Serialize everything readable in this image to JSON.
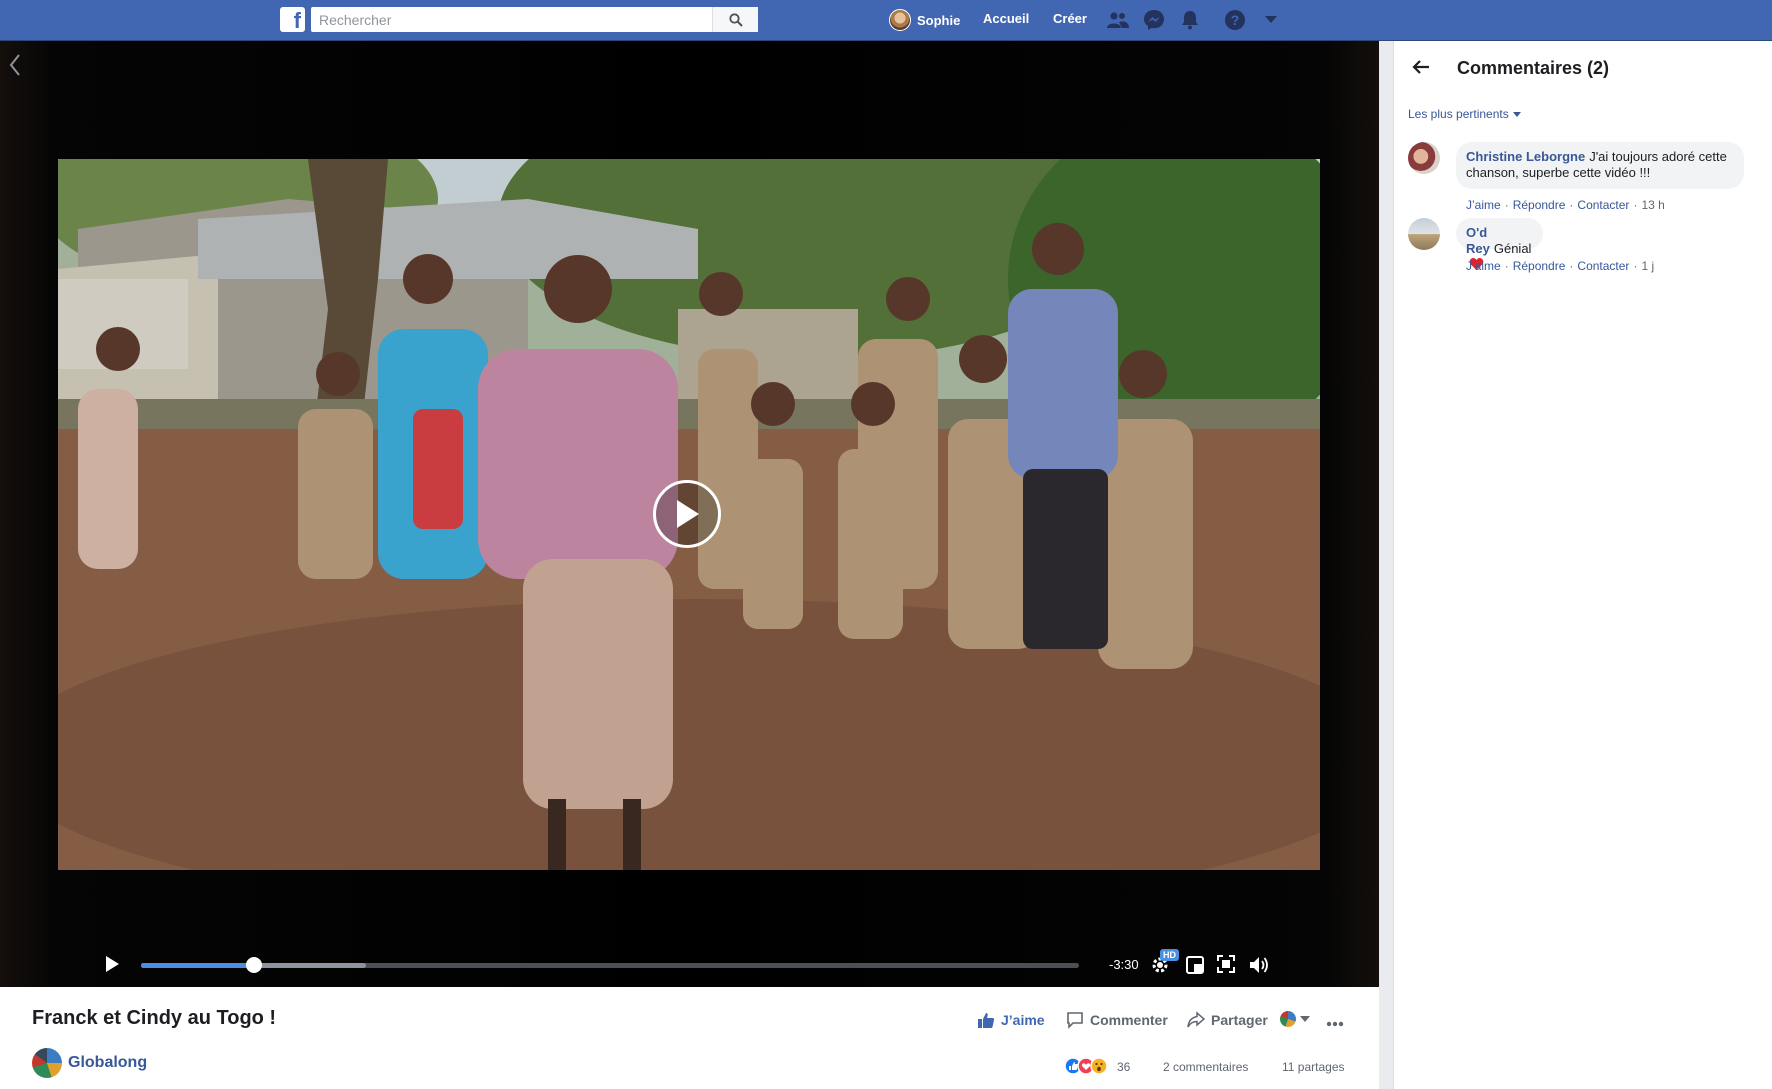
{
  "topbar": {
    "logo": "f",
    "search_placeholder": "Rechercher",
    "user_name": "Sophie",
    "home_label": "Accueil",
    "create_label": "Créer",
    "icons": [
      "friends-icon",
      "messenger-icon",
      "notifications-icon",
      "help-icon",
      "account-menu-icon"
    ],
    "brand_color": "#4267b2"
  },
  "player": {
    "remaining_time": "-3:30",
    "quality_badge": "HD",
    "progress_fraction": 0.12,
    "buffered_fraction": 0.24,
    "accent_color": "#4a90e2"
  },
  "post": {
    "title": "Franck et Cindy au Togo !",
    "page_name": "Globalong",
    "like_label": "J’aime",
    "comment_label": "Commenter",
    "share_label": "Partager",
    "reactions_count": "36",
    "comments_count": "2 commentaires",
    "shares_count": "11 partages"
  },
  "comments_panel": {
    "title": "Commentaires (2)",
    "sort_label": "Les plus pertinents",
    "like_action": "J’aime",
    "reply_action": "Répondre",
    "contact_action": "Contacter",
    "items": [
      {
        "author": "Christine Leborgne",
        "text": "J'ai toujours adoré cette chanson, superbe cette vidéo !!!",
        "time": "13 h"
      },
      {
        "author": "O'd Rey",
        "text": "Génial",
        "time": "1 j"
      }
    ]
  }
}
